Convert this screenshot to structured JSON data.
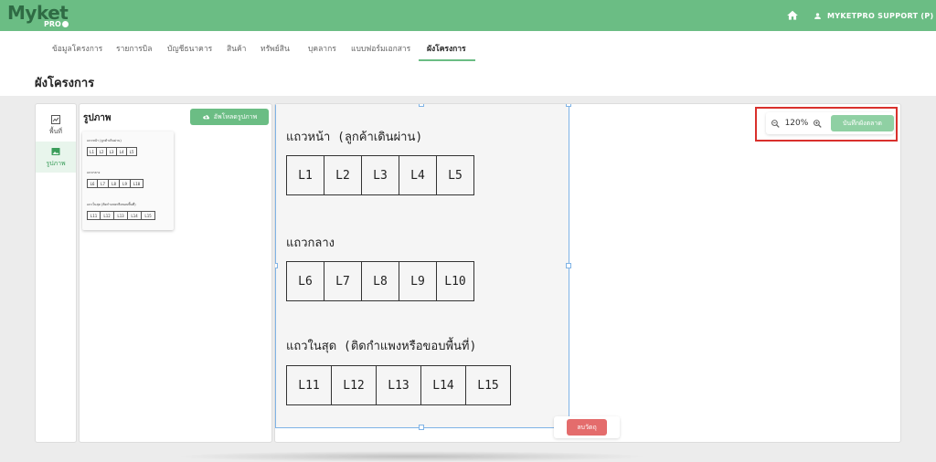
{
  "app": {
    "logo_text": "Myket",
    "logo_sub": "PRO",
    "user_name": "MYKETPRO SUPPORT (P)",
    "brand_color": "#6bbd84"
  },
  "nav": {
    "tabs": [
      {
        "label": "ข้อมูลโครงการ"
      },
      {
        "label": "รายการบิล"
      },
      {
        "label": "บัญชีธนาคาร"
      },
      {
        "label": "สินค้า"
      },
      {
        "label": "ทรัพย์สิน"
      },
      {
        "label": "บุคลากร"
      },
      {
        "label": "แบบฟอร์มเอกสาร"
      },
      {
        "label": "ผังโครงการ",
        "active": true
      }
    ]
  },
  "page": {
    "title": "ผังโครงการ"
  },
  "sidebar": {
    "items": [
      {
        "label": "พื้นที่",
        "icon": "area-chart-icon"
      },
      {
        "label": "รูปภาพ",
        "icon": "image-icon",
        "active": true
      }
    ]
  },
  "images_panel": {
    "title": "รูปภาพ",
    "upload_label": "อัพโหลดรูปภาพ"
  },
  "toolbar": {
    "zoom_value": "120%",
    "save_label": "บันทึกผังตลาด",
    "delete_label": "ลบวัตถุ"
  },
  "floorplan": {
    "rows": [
      {
        "label": "แถวหน้า (ลูกค้าเดินผ่าน)",
        "lots": [
          "L1",
          "L2",
          "L3",
          "L4",
          "L5"
        ]
      },
      {
        "label": "แถวกลาง",
        "lots": [
          "L6",
          "L7",
          "L8",
          "L9",
          "L10"
        ]
      },
      {
        "label": "แถวในสุด (ติดกำแพงหรือขอบพื้นที่)",
        "lots": [
          "L11",
          "L12",
          "L13",
          "L14",
          "L15"
        ]
      }
    ]
  }
}
